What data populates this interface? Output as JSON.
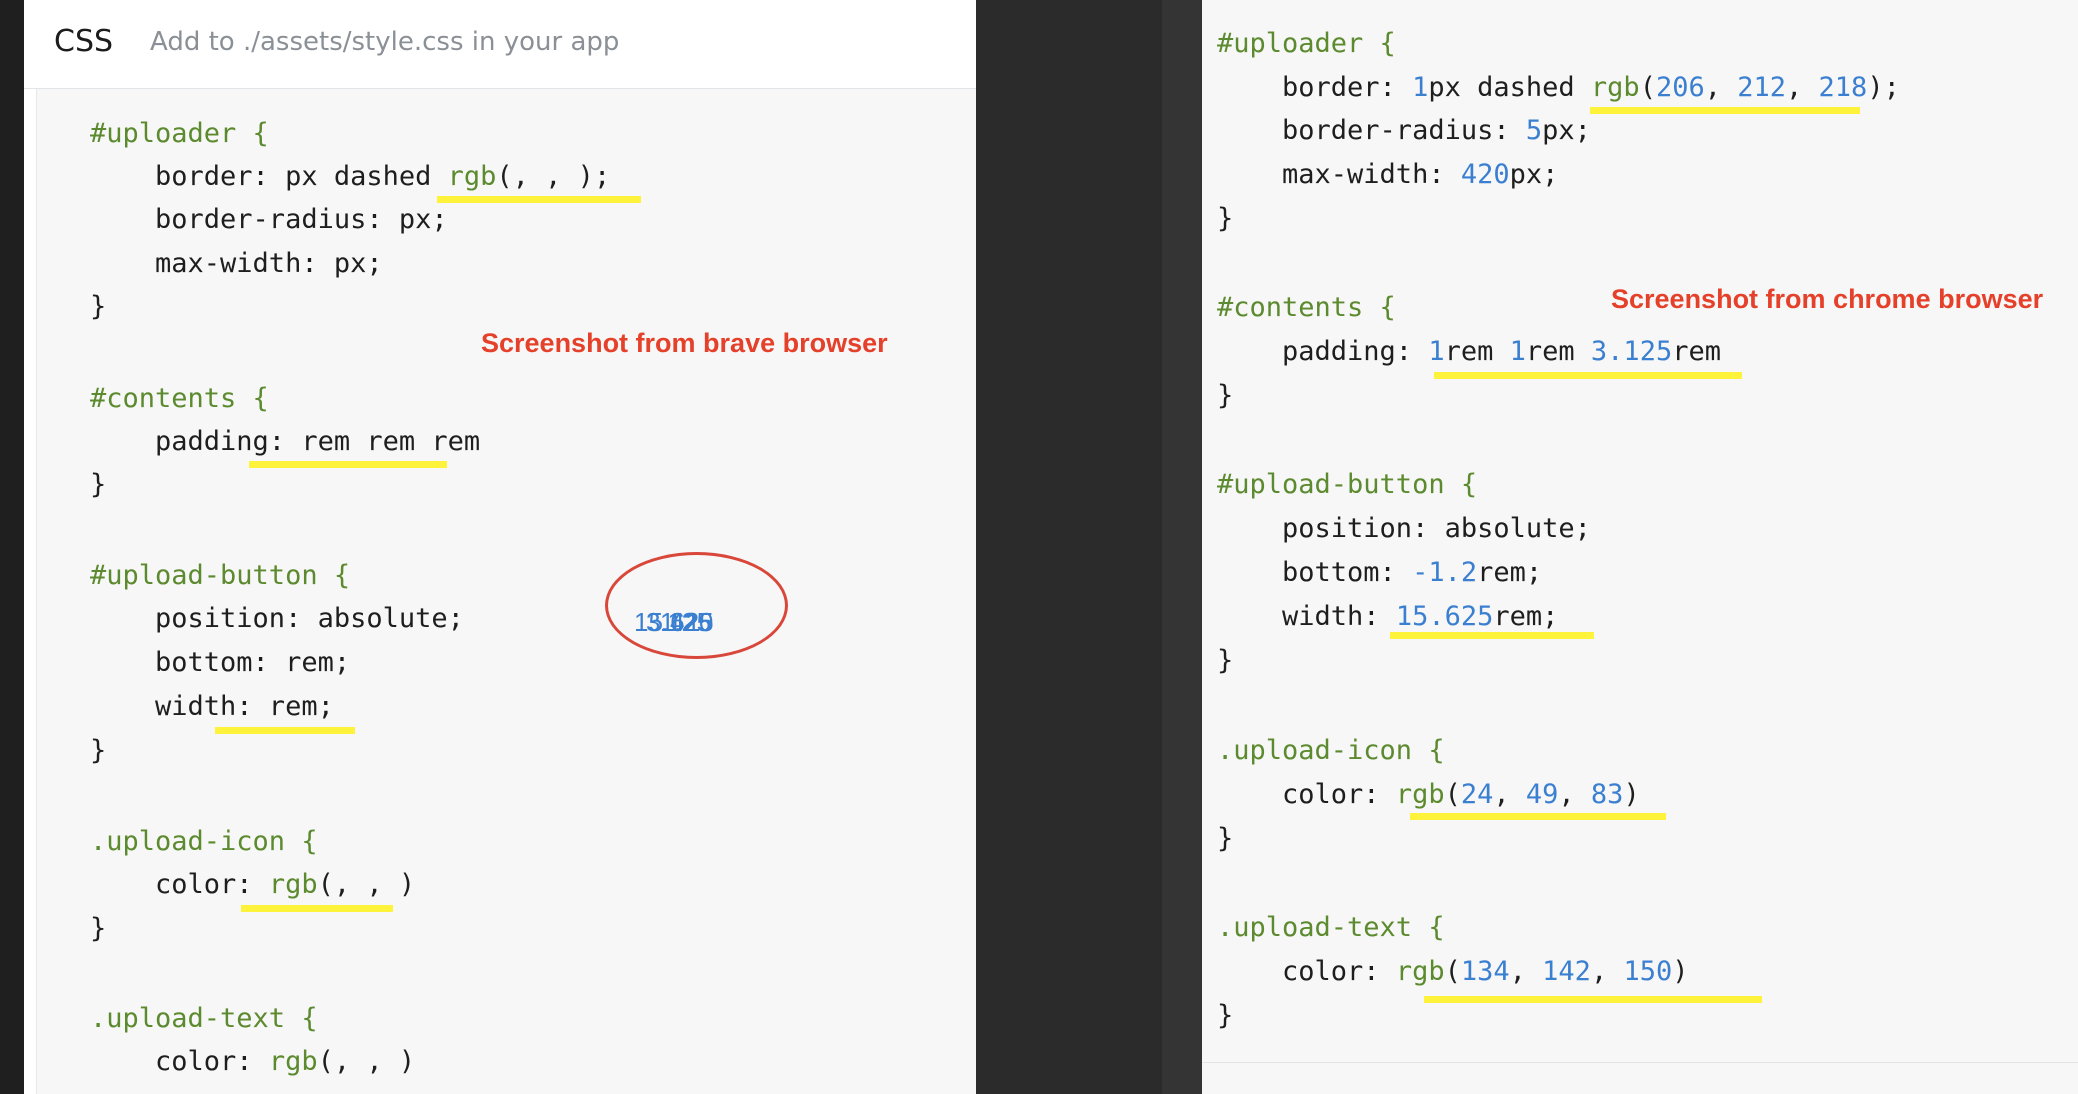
{
  "header": {
    "title": "CSS",
    "subtitle": "Add to ./assets/style.css in your app"
  },
  "annotations": {
    "brave_note": "Screenshot from brave browser",
    "chrome_note": "Screenshot from chrome browser",
    "overlap_glyphs": [
      "15.625",
      "3.125",
      "1.2",
      "420",
      "1"
    ]
  },
  "colors": {
    "selector": "#5c8a2e",
    "number": "#3b7fd1",
    "highlight": "#fff23a",
    "annotation": "#e5402a"
  },
  "left_code": {
    "uploader_open": "#uploader {",
    "border": "    border: px dashed rgb(, , );",
    "border_radius": "    border-radius: px;",
    "max_width": "    max-width: px;",
    "close_1": "}",
    "contents_open": "#contents {",
    "padding": "    padding: rem rem rem",
    "close_2": "}",
    "upload_button_open": "#upload-button {",
    "position": "    position: absolute;",
    "bottom": "    bottom: rem;",
    "width": "    width: rem;",
    "close_3": "}",
    "upload_icon_open": ".upload-icon {",
    "icon_color": "    color: rgb(, , )",
    "close_4": "}",
    "upload_text_open": ".upload-text {",
    "text_color": "    color: rgb(, , )"
  },
  "right_code": {
    "uploader_open": "#uploader {",
    "border_prefix": "    border: ",
    "border_width": "1",
    "border_mid": "px dashed ",
    "border_fn": "rgb",
    "border_r": "206",
    "border_g": "212",
    "border_b": "218",
    "radius_prefix": "    border-radius: ",
    "radius_value": "5",
    "max_prefix": "    max-width: ",
    "max_value": "420",
    "close_1": "}",
    "contents_open": "#contents {",
    "padding_prefix": "    padding: ",
    "padding_a": "1",
    "padding_b": "1",
    "padding_c": "3.125",
    "close_2": "}",
    "upload_button_open": "#upload-button {",
    "position": "    position: absolute;",
    "bottom_prefix": "    bottom: ",
    "bottom_value": "-1.2",
    "width_prefix": "    width: ",
    "width_value": "15.625",
    "close_3": "}",
    "upload_icon_open": ".upload-icon {",
    "icon_prefix": "    color: ",
    "icon_r": "24",
    "icon_g": "49",
    "icon_b": "83",
    "close_4": "}",
    "upload_text_open": ".upload-text {",
    "text_prefix": "    color: ",
    "text_r": "134",
    "text_g": "142",
    "text_b": "150",
    "close_5": "}"
  }
}
